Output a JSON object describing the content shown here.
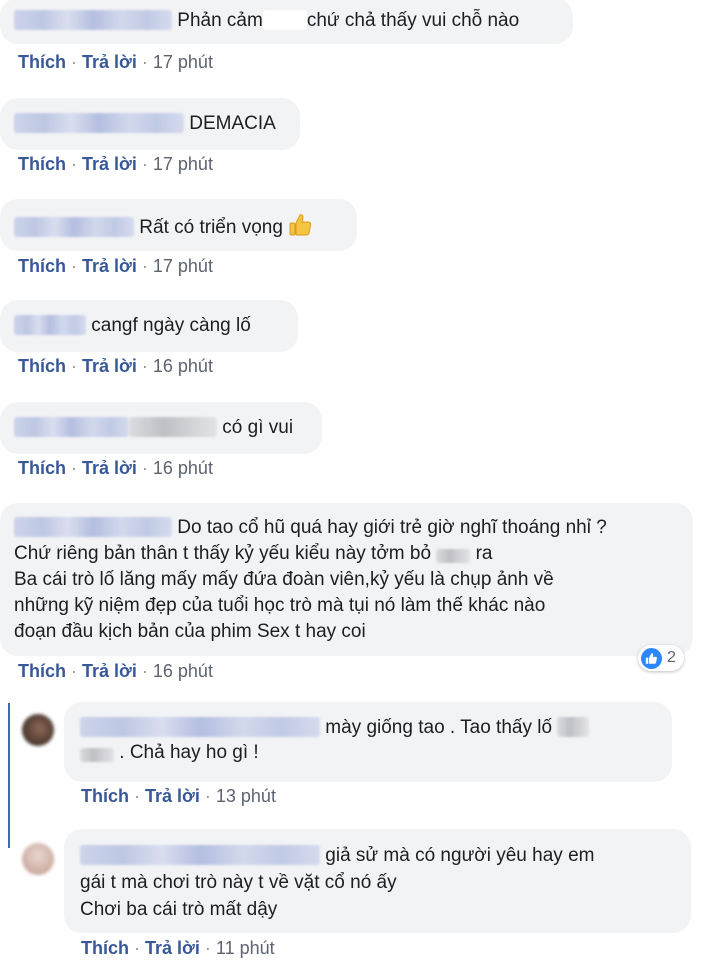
{
  "actions": {
    "like": "Thích",
    "reply": "Trả lời",
    "separator": "·"
  },
  "comments": [
    {
      "lines": [
        "Phản cảm",
        "chứ chả thấy vui chỗ nào"
      ],
      "time": "17 phút"
    },
    {
      "lines": [
        "DEMACIA"
      ],
      "time": "17 phút"
    },
    {
      "lines": [
        "Rất có triển vọng"
      ],
      "emoji": "thumbs-up-emoji",
      "time": "17 phút"
    },
    {
      "lines": [
        "cangf ngày càng lố"
      ],
      "time": "16 phút"
    },
    {
      "lines": [
        "có gì vui"
      ],
      "time": "16 phút"
    },
    {
      "lines": [
        "Do tao cổ hũ quá hay giới trẻ giờ nghĩ thoáng nhỉ ?",
        "Chứ riêng bản thân t thấy kỷ yếu kiểu này tởm bỏ",
        "ra",
        "Ba cái trò lố lăng mấy mấy đứa đoàn viên,kỷ yếu là chụp ảnh về",
        "những kỹ niệm đẹp của tuổi học trò mà tụi nó làm thế khác nào",
        "đoạn đầu kịch bản của phim Sex t hay coi"
      ],
      "time": "16 phút",
      "reaction": {
        "icon": "like-icon",
        "count": "2"
      }
    }
  ],
  "replies": [
    {
      "lines": [
        "mày giống tao . Tao thấy lố",
        ". Chả hay ho gì !"
      ],
      "time": "13 phút"
    },
    {
      "lines": [
        "giả sử mà có người yêu hay em",
        "gái t mà chơi trò này t về vặt cổ nó ấy",
        "Chơi ba cái trò mất dậy"
      ],
      "time": "11 phút"
    }
  ]
}
